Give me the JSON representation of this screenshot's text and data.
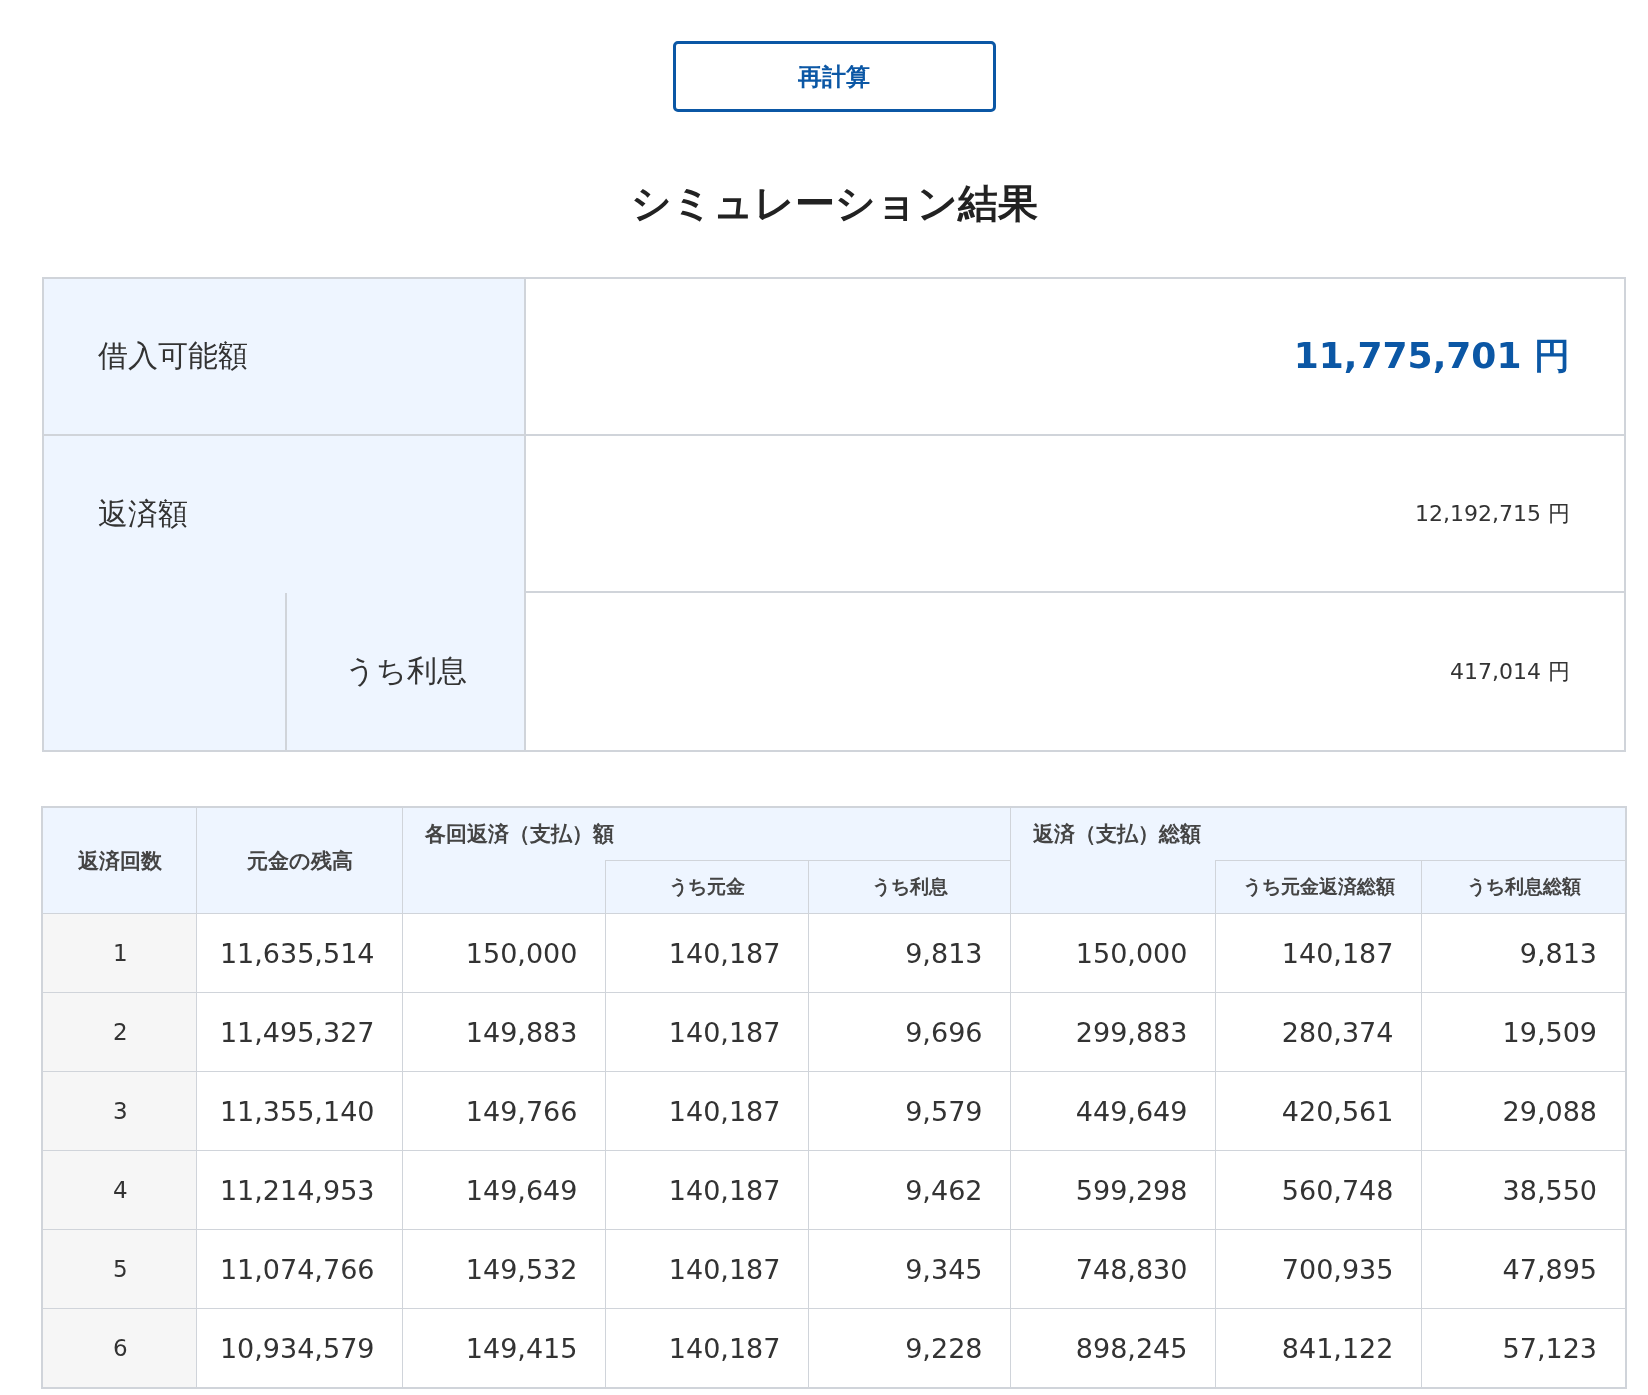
{
  "recalc_button": "再計算",
  "title": "シミュレーション結果",
  "summary": {
    "borrowable": {
      "label": "借入可能額",
      "value": "11,775,701 円"
    },
    "repayment": {
      "label": "返済額",
      "value": "12,192,715 円"
    },
    "interest": {
      "label": "うち利息",
      "value": "417,014 円"
    }
  },
  "schedule": {
    "headers": {
      "count": "返済回数",
      "balance": "元金の残高",
      "each": "各回返済（支払）額",
      "each_principal": "うち元金",
      "each_interest": "うち利息",
      "total": "返済（支払）総額",
      "total_principal": "うち元金返済総額",
      "total_interest": "うち利息総額"
    },
    "rows": [
      [
        "1",
        "11,635,514",
        "150,000",
        "140,187",
        "9,813",
        "150,000",
        "140,187",
        "9,813"
      ],
      [
        "2",
        "11,495,327",
        "149,883",
        "140,187",
        "9,696",
        "299,883",
        "280,374",
        "19,509"
      ],
      [
        "3",
        "11,355,140",
        "149,766",
        "140,187",
        "9,579",
        "449,649",
        "420,561",
        "29,088"
      ],
      [
        "4",
        "11,214,953",
        "149,649",
        "140,187",
        "9,462",
        "599,298",
        "560,748",
        "38,550"
      ],
      [
        "5",
        "11,074,766",
        "149,532",
        "140,187",
        "9,345",
        "748,830",
        "700,935",
        "47,895"
      ],
      [
        "6",
        "10,934,579",
        "149,415",
        "140,187",
        "9,228",
        "898,245",
        "841,122",
        "57,123"
      ]
    ]
  }
}
